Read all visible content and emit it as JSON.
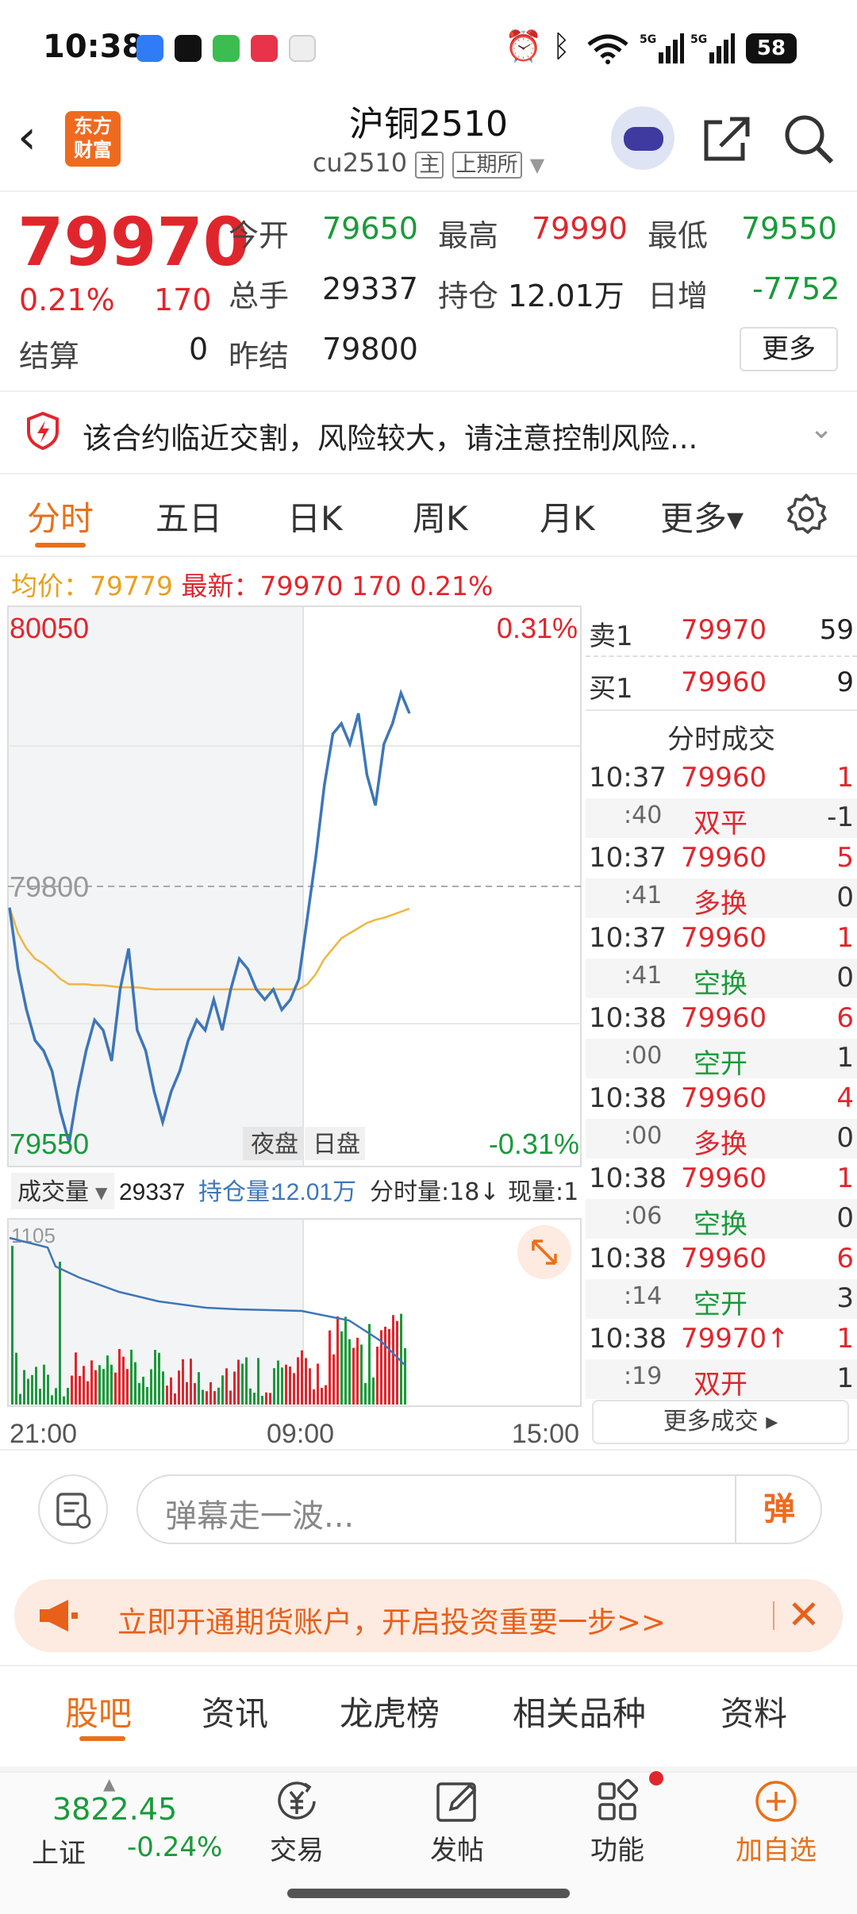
{
  "status_bar": {
    "time": "10:38",
    "battery": "58"
  },
  "header": {
    "back": "‹",
    "logo": [
      "东方",
      "财富"
    ],
    "title": "沪铜2510",
    "code": "cu2510",
    "tag_main": "主",
    "tag_exchange": "上期所"
  },
  "quote": {
    "price": "79970",
    "pct": "0.21%",
    "change": "170",
    "settle_label": "结算",
    "settle": "0",
    "open_label": "今开",
    "open": "79650",
    "high_label": "最高",
    "high": "79990",
    "low_label": "最低",
    "low": "79550",
    "volume_label": "总手",
    "volume": "29337",
    "oi_label": "持仓",
    "oi": "12.01万",
    "daily_inc_label": "日增",
    "daily_inc": "-7752",
    "prev_settle_label": "昨结",
    "prev_settle": "79800",
    "more": "更多"
  },
  "risk_notice": "该合约临近交割，风险较大，请注意控制风险...",
  "tabs": [
    "分时",
    "五日",
    "日K",
    "周K",
    "月K",
    "更多▾"
  ],
  "avg_row": {
    "avg_label": "均价：",
    "avg": "79779",
    "latest_label": "最新：",
    "latest": "79970",
    "change": "170",
    "pct": "0.21%"
  },
  "chart": {
    "y_max": "80050",
    "y_mid": "79800",
    "y_min": "79550",
    "pct_max": "0.31%",
    "pct_min": "-0.31%",
    "session_night": "夜盘",
    "session_day": "日盘",
    "vol_label": "成交量",
    "vol_value": "29337",
    "oi_label": "持仓量:",
    "oi_value": "12.01万",
    "min_vol_label": "分时量:18↓",
    "cur_vol_label": "现量:1",
    "vol_max": "1105",
    "x_ticks": [
      "21:00",
      "09:00",
      "15:00"
    ]
  },
  "chart_data": {
    "type": "line",
    "title": "",
    "xlabel": "",
    "ylabel": "",
    "x_range": [
      "21:00",
      "15:00"
    ],
    "ylim": [
      79550,
      80050
    ],
    "series": [
      {
        "name": "",
        "values": [
          79780,
          79720,
          79680,
          79650,
          79640,
          79620,
          79580,
          79550,
          79600,
          79640,
          79670,
          79660,
          79630,
          79700,
          79740,
          79660,
          79640,
          79600,
          79570,
          79600,
          79620,
          79650,
          79670,
          79660,
          79690,
          79660,
          79700,
          79730,
          79720,
          79700,
          79690,
          79700,
          79680,
          79690,
          79710,
          79770,
          79830,
          79900,
          79950,
          79960,
          79940,
          79970,
          79910,
          79880,
          79940,
          79960,
          79990,
          79970
        ]
      },
      {
        "name": "均价",
        "values": [
          79780,
          79755,
          79740,
          79730,
          79725,
          79718,
          79710,
          79705,
          79705,
          79705,
          79704,
          79704,
          79703,
          79702,
          79702,
          79702,
          79701,
          79700,
          79700,
          79700,
          79700,
          79700,
          79700,
          79700,
          79700,
          79700,
          79700,
          79700,
          79700,
          79700,
          79700,
          79700,
          79700,
          79700,
          79700,
          79705,
          79715,
          79730,
          79740,
          79750,
          79755,
          79760,
          79765,
          79768,
          79770,
          79773,
          79776,
          79779
        ]
      }
    ]
  },
  "order_book": {
    "ask": {
      "label": "卖1",
      "price": "79970",
      "qty": "59"
    },
    "bid": {
      "label": "买1",
      "price": "79960",
      "qty": "9"
    },
    "trades_title": "分时成交",
    "trades": [
      {
        "time": "10:37",
        "price": "79960",
        "qty": "1",
        "sub": ":40",
        "type": "双平",
        "oi": "-1"
      },
      {
        "time": "10:37",
        "price": "79960",
        "qty": "5",
        "sub": ":41",
        "type": "多换",
        "oi": "0"
      },
      {
        "time": "10:37",
        "price": "79960",
        "qty": "1",
        "sub": ":41",
        "type": "空换",
        "oi": "0"
      },
      {
        "time": "10:38",
        "price": "79960",
        "qty": "6",
        "sub": ":00",
        "type": "空开",
        "oi": "1"
      },
      {
        "time": "10:38",
        "price": "79960",
        "qty": "4",
        "sub": ":00",
        "type": "多换",
        "oi": "0"
      },
      {
        "time": "10:38",
        "price": "79960",
        "qty": "1",
        "sub": ":06",
        "type": "空换",
        "oi": "0"
      },
      {
        "time": "10:38",
        "price": "79960",
        "qty": "6",
        "sub": ":14",
        "type": "空开",
        "oi": "3"
      },
      {
        "time": "10:38",
        "price": "79970↑",
        "qty": "1",
        "sub": ":19",
        "type": "双开",
        "oi": "1"
      }
    ],
    "more": "更多成交 ▸"
  },
  "danmaku": {
    "placeholder": "弹幕走一波...",
    "button": "弹"
  },
  "promo": {
    "text": "立即开通期货账户，开启投资重要一步>>",
    "close": "✕"
  },
  "bottom_tabs": [
    "股吧",
    "资讯",
    "龙虎榜",
    "相关品种",
    "资料"
  ],
  "toolbar": {
    "index_value": "3822.45",
    "index_name": "上证",
    "index_pct": "-0.24%",
    "items": [
      "交易",
      "发帖",
      "功能",
      "加自选"
    ]
  },
  "colors": {
    "up": "#e0262d",
    "down": "#1a9a3a",
    "accent": "#e8701a",
    "price_line": "#3d76b8",
    "avg_line": "#f0b63f"
  }
}
